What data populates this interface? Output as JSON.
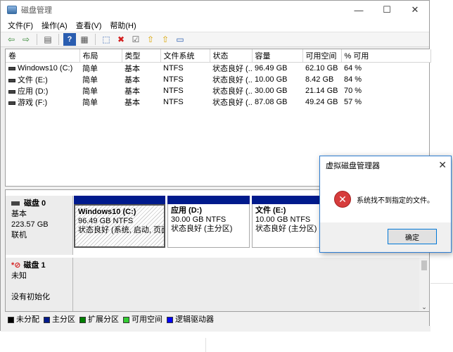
{
  "window": {
    "title": "磁盘管理",
    "controls": {
      "minimize": "—",
      "maximize": "☐",
      "close": "✕"
    }
  },
  "menu": [
    "文件(F)",
    "操作(A)",
    "查看(V)",
    "帮助(H)"
  ],
  "toolbar": {
    "icons": [
      "back-arrow-icon",
      "forward-arrow-icon",
      "console-icon",
      "help-icon",
      "properties-icon",
      "connect-icon",
      "delete-icon",
      "check-icon",
      "export-icon",
      "folder-open-icon",
      "list-view-icon"
    ],
    "glyphs": [
      "⇦",
      "⇨",
      "▤",
      "?",
      "▦",
      "⬚",
      "✖",
      "☑",
      "⇧",
      "⇧",
      "▭"
    ]
  },
  "volume_table": {
    "headers": [
      "卷",
      "布局",
      "类型",
      "文件系统",
      "状态",
      "容量",
      "可用空间",
      "% 可用"
    ],
    "rows": [
      [
        "Windows10 (C:)",
        "简单",
        "基本",
        "NTFS",
        "状态良好 (...",
        "96.49 GB",
        "62.10 GB",
        "64 %"
      ],
      [
        "文件 (E:)",
        "简单",
        "基本",
        "NTFS",
        "状态良好 (...",
        "10.00 GB",
        "8.42 GB",
        "84 %"
      ],
      [
        "应用 (D:)",
        "简单",
        "基本",
        "NTFS",
        "状态良好 (...",
        "30.00 GB",
        "21.14 GB",
        "70 %"
      ],
      [
        "游戏 (F:)",
        "简单",
        "基本",
        "NTFS",
        "状态良好 (...",
        "87.08 GB",
        "49.24 GB",
        "57 %"
      ]
    ]
  },
  "disk0": {
    "name": "磁盘 0",
    "type": "基本",
    "size": "223.57 GB",
    "status": "联机",
    "partitions": [
      {
        "title": "Windows10  (C:)",
        "size": "96.49 GB NTFS",
        "status": "状态良好 (系统, 启动, 页面文"
      },
      {
        "title": "应用  (D:)",
        "size": "30.00 GB NTFS",
        "status": "状态良好 (主分区)"
      },
      {
        "title": "文件  (E:)",
        "size": "10.00 GB NTFS",
        "status": "状态良好 (主分区)"
      }
    ]
  },
  "disk1": {
    "name": "磁盘 1",
    "type": "未知",
    "status": "没有初始化"
  },
  "legend": [
    {
      "label": "未分配",
      "color": "#000000"
    },
    {
      "label": "主分区",
      "color": "#001a8c"
    },
    {
      "label": "扩展分区",
      "color": "#008000"
    },
    {
      "label": "可用空间",
      "color": "#33cc33"
    },
    {
      "label": "逻辑驱动器",
      "color": "#0000ff"
    }
  ],
  "dialog": {
    "title": "虚拟磁盘管理器",
    "close": "✕",
    "message": "系统找不到指定的文件。",
    "ok_label": "确定"
  }
}
